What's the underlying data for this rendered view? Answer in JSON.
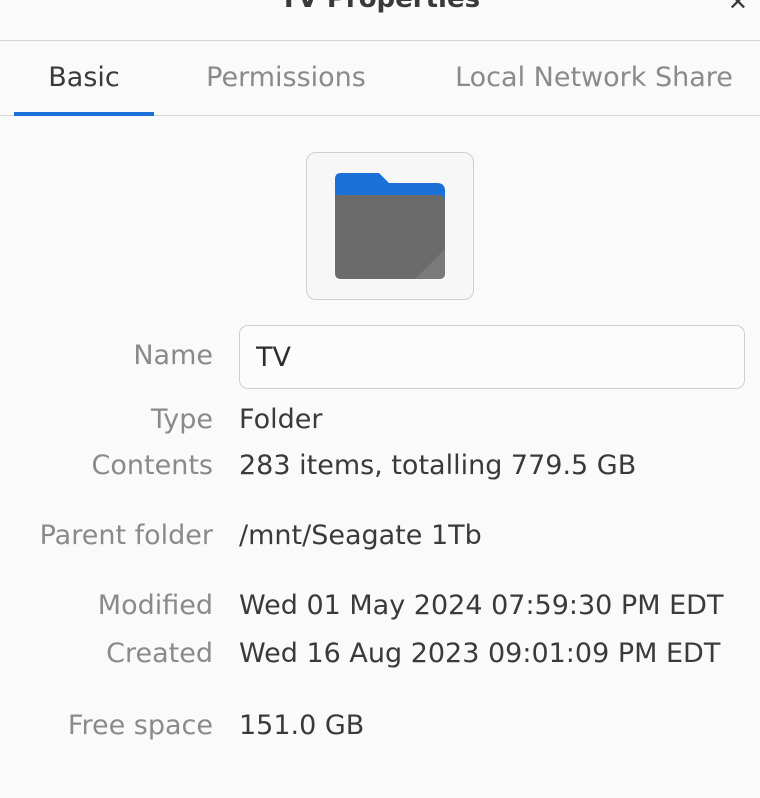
{
  "window": {
    "title": "TV Properties",
    "close_glyph": "✕"
  },
  "tabs": [
    {
      "label": "Basic",
      "active": true
    },
    {
      "label": "Permissions",
      "active": false
    },
    {
      "label": "Local Network Share",
      "active": false
    }
  ],
  "icon": {
    "name": "folder-icon",
    "accent_color": "#1c71d8",
    "body_color": "#6b6b6b"
  },
  "properties": {
    "name": {
      "label": "Name",
      "value": "TV"
    },
    "type": {
      "label": "Type",
      "value": "Folder"
    },
    "contents": {
      "label": "Contents",
      "value": "283 items, totalling 779.5 GB"
    },
    "parent_folder": {
      "label": "Parent folder",
      "value": "/mnt/Seagate 1Tb"
    },
    "modified": {
      "label": "Modified",
      "value": "Wed 01 May 2024 07:59:30 PM EDT"
    },
    "created": {
      "label": "Created",
      "value": "Wed 16 Aug 2023 09:01:09 PM EDT"
    },
    "free_space": {
      "label": "Free space",
      "value": "151.0 GB"
    }
  }
}
